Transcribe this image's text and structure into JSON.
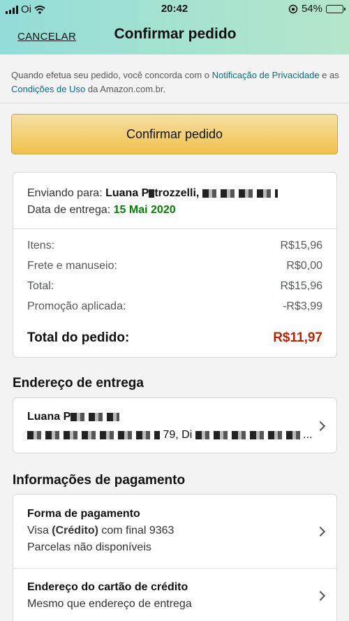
{
  "status_bar": {
    "carrier": "Oi",
    "time": "20:42",
    "battery": "54%",
    "battery_level": 0.54
  },
  "header": {
    "cancel_label": "CANCELAR",
    "title": "Confirmar pedido"
  },
  "terms": {
    "prefix": "Quando efetua seu pedido, você concorda com o ",
    "privacy_link": "Notificação de Privacidade",
    "middle": " e as ",
    "terms_link": "Condições de Uso",
    "suffix": " da Amazon.com.br."
  },
  "confirm_button": "Confirmar pedido",
  "summary": {
    "ship_to_label": "Enviando para:",
    "ship_to_name": "Luana P",
    "ship_to_name2": "trozzelli,",
    "delivery_label": "Data de entrega:",
    "delivery_date": "15 Mai 2020",
    "rows": [
      {
        "label": "Itens:",
        "value": "R$15,96"
      },
      {
        "label": "Frete e manuseio:",
        "value": "R$0,00"
      },
      {
        "label": "Total:",
        "value": "R$15,96"
      },
      {
        "label": "Promoção aplicada:",
        "value": "-R$3,99"
      }
    ],
    "total_label": "Total do pedido:",
    "total_value": "R$11,97"
  },
  "address_section": {
    "title": "Endereço de entrega",
    "name": "Luana P",
    "line_mid": "79, Di",
    "line_end": "..."
  },
  "payment_section": {
    "title": "Informações de pagamento",
    "method_title": "Forma de pagamento",
    "card_prefix": "Visa ",
    "card_type": "(Crédito)",
    "card_suffix": " com final 9363",
    "installments": "Parcelas não disponíveis",
    "billing_title": "Endereço do cartão de crédito",
    "billing_value": "Mesmo que endereço de entrega"
  }
}
